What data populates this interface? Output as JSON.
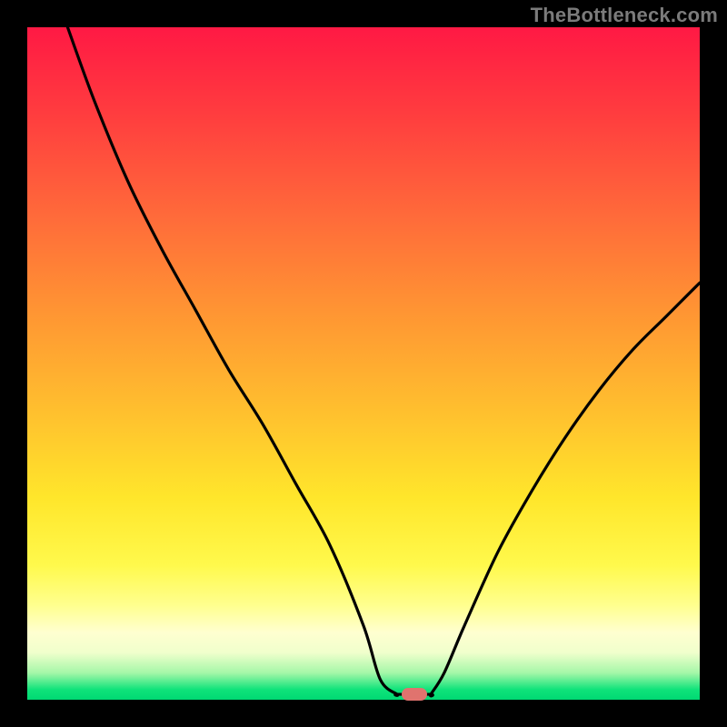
{
  "watermark": "TheBottleneck.com",
  "chart_data": {
    "type": "line",
    "title": "",
    "xlabel": "",
    "ylabel": "",
    "xlim": [
      0,
      100
    ],
    "ylim": [
      0,
      100
    ],
    "grid": false,
    "legend": false,
    "series": [
      {
        "name": "left-branch",
        "x": [
          6,
          10,
          15,
          20,
          25,
          30,
          35,
          40,
          45,
          50,
          52.5,
          55
        ],
        "values": [
          100,
          89,
          77,
          67,
          58,
          49,
          41,
          32,
          23,
          11,
          3,
          0.8
        ]
      },
      {
        "name": "right-branch",
        "x": [
          60,
          62,
          65,
          70,
          75,
          80,
          85,
          90,
          95,
          100
        ],
        "values": [
          0.8,
          4,
          11,
          22,
          31,
          39,
          46,
          52,
          57,
          62
        ]
      }
    ],
    "flat_bottom": {
      "x_start": 55,
      "x_end": 60,
      "value": 0.8
    },
    "marker": {
      "x": 57.5,
      "y": 0.8,
      "color": "#e0736e"
    },
    "gradient_stops": [
      {
        "pct": 0,
        "color": "#ff1944"
      },
      {
        "pct": 28,
        "color": "#ff6a3a"
      },
      {
        "pct": 58,
        "color": "#ffc22e"
      },
      {
        "pct": 80,
        "color": "#fff94c"
      },
      {
        "pct": 93,
        "color": "#f0ffcc"
      },
      {
        "pct": 100,
        "color": "#00d973"
      }
    ]
  }
}
